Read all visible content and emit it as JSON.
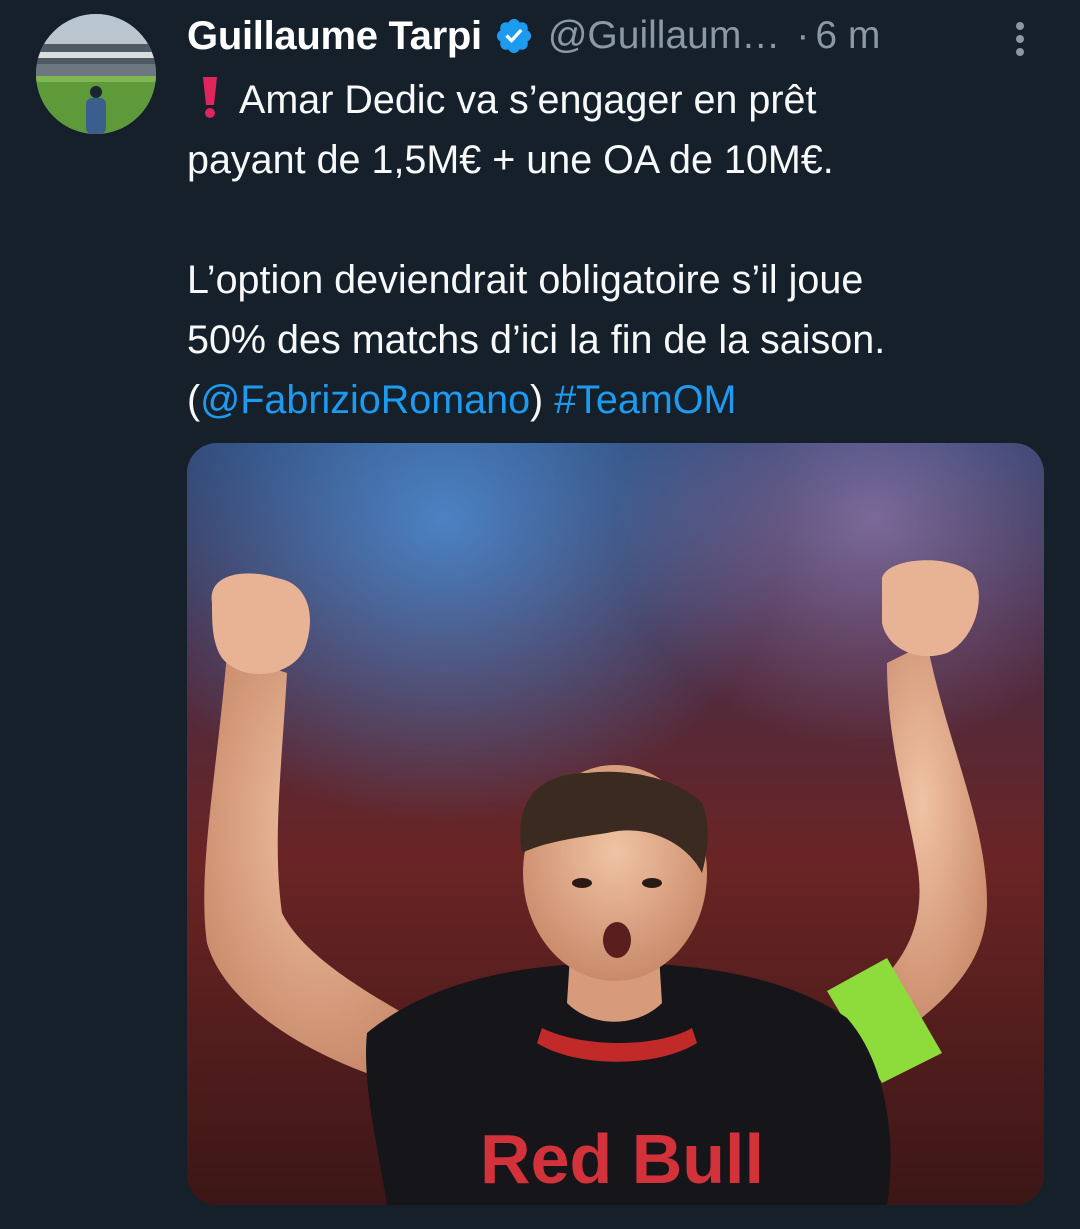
{
  "tweet": {
    "display_name": "Guillaume Tarpi",
    "handle": "@Guillaum…",
    "separator": "·",
    "time": "6 m",
    "line1": "Amar Dedic va s’engager en prêt",
    "line2": "payant de 1,5M€ + une OA de 10M€.",
    "line3": "L’option deviendrait obligatoire s’il joue",
    "line4": "50% des matchs d’ici la fin de la saison.",
    "open_paren": "(",
    "mention": "@FabrizioRomano",
    "close_paren": ")",
    "hashtag": "#TeamOM",
    "media_sponsor_text": "Red Bull"
  },
  "icons": {
    "verified": "verified-badge-icon",
    "more": "more-vertical-icon",
    "exclamation": "red-exclamation-icon"
  },
  "colors": {
    "background": "#15202b",
    "link": "#1d9bf0",
    "secondary_text": "#8b98a5",
    "verified": "#1d9bf0",
    "exclamation": "#e0245e"
  }
}
